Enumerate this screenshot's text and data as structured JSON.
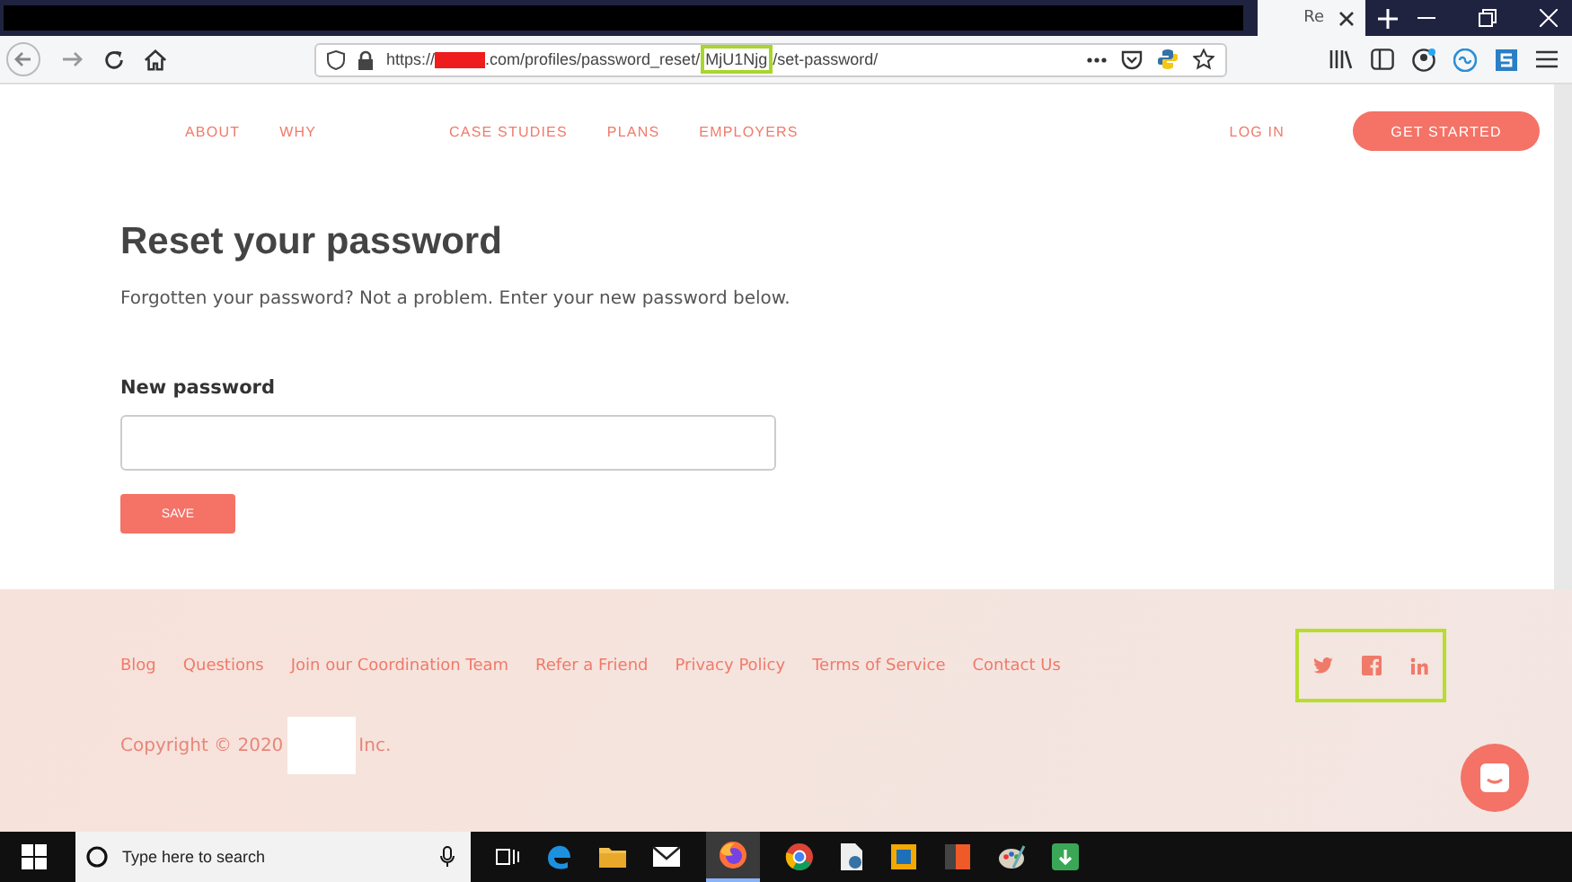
{
  "browser": {
    "tab_title": "Re",
    "url": {
      "scheme": "https://",
      "host_end": ".com/profiles/password_reset/",
      "token": "MjU1Njg",
      "rest": "/set-password/"
    }
  },
  "nav": {
    "links": [
      "ABOUT",
      "WHY",
      "CASE STUDIES",
      "PLANS",
      "EMPLOYERS"
    ],
    "login": "LOG IN",
    "cta": "GET STARTED"
  },
  "form": {
    "title": "Reset your password",
    "subtitle": "Forgotten your password? Not a problem. Enter your new password below.",
    "field_label": "New password",
    "button": "SAVE"
  },
  "footer": {
    "links": [
      "Blog",
      "Questions",
      "Join our Coordination Team",
      "Refer a Friend",
      "Privacy Policy",
      "Terms of Service",
      "Contact Us"
    ],
    "copyright_start": "Copyright © 2020",
    "copyright_end": "Inc."
  },
  "taskbar": {
    "search_placeholder": "Type here to search"
  }
}
